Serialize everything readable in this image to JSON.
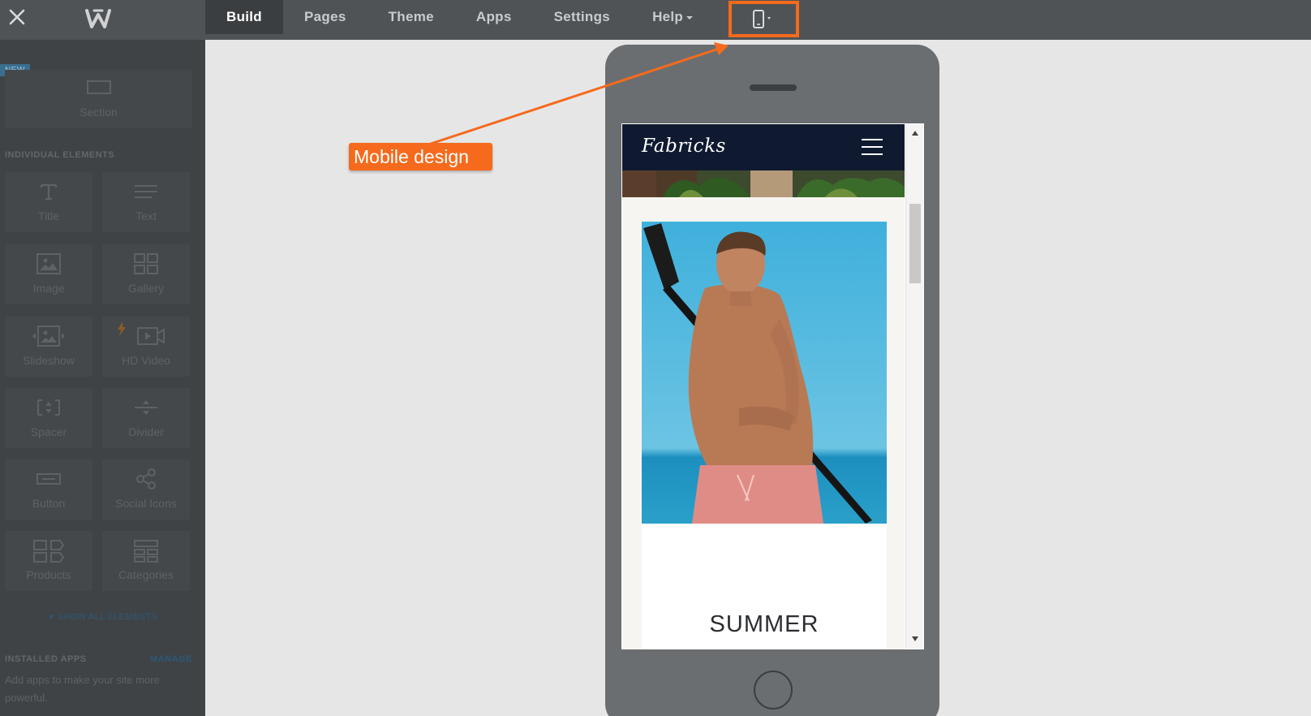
{
  "topbar": {
    "nav_tabs": [
      {
        "label": "Build"
      },
      {
        "label": "Pages"
      },
      {
        "label": "Theme"
      },
      {
        "label": "Apps"
      },
      {
        "label": "Settings"
      },
      {
        "label": "Help"
      }
    ],
    "device_toggle_icon": "mobile-phone-icon"
  },
  "leftpanel": {
    "new_badge": "NEW",
    "section_tile_label": "Section",
    "individual_elements_heading": "INDIVIDUAL ELEMENTS",
    "elements": [
      {
        "label": "Title",
        "icon": "title-icon"
      },
      {
        "label": "Text",
        "icon": "text-icon"
      },
      {
        "label": "Image",
        "icon": "image-icon"
      },
      {
        "label": "Gallery",
        "icon": "gallery-icon"
      },
      {
        "label": "Slideshow",
        "icon": "slideshow-icon"
      },
      {
        "label": "HD Video",
        "icon": "video-icon"
      },
      {
        "label": "Spacer",
        "icon": "spacer-icon"
      },
      {
        "label": "Divider",
        "icon": "divider-icon"
      },
      {
        "label": "Button",
        "icon": "button-icon"
      },
      {
        "label": "Social Icons",
        "icon": "social-icon"
      },
      {
        "label": "Products",
        "icon": "products-icon"
      },
      {
        "label": "Categories",
        "icon": "categories-icon"
      }
    ],
    "show_all": "SHOW ALL ELEMENTS",
    "installed_apps_heading": "INSTALLED APPS",
    "manage": "MANAGE",
    "apps_description": "Add apps to make your site more powerful."
  },
  "preview": {
    "site_logo": "Fabricks",
    "hero_heading": "SUMMER"
  },
  "annotation": {
    "label": "Mobile design"
  },
  "colors": {
    "accent": "#f56a1c",
    "topbar": "#4f5356",
    "sidebar": "#3f4346",
    "site_header": "#0f1a30"
  }
}
